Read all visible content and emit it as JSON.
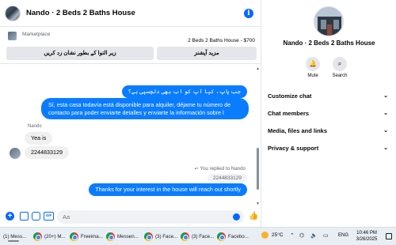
{
  "chat": {
    "title": "Nando · 2 Beds 2 Baths House",
    "marketplace_label": "Marketplace",
    "listing": "2 Beds 2 Baths House - $700",
    "btn_mark": "زیر التوا کے بطور نشان زد کریں",
    "btn_options": "مزید آپشنز",
    "messages": {
      "m1": "جب پاپ، کیا آپ کو اب بھی دلچسپی ہے؟",
      "m2": "Sí, esta casa todavía está disponible para alquiler, déjame tu número de contacto para poder enviarte detalles y enviarte la información sobre l",
      "sender": "Nando",
      "m3": "Yea is",
      "m4": "2244833129",
      "replied": "You replied to Nando",
      "quoted": "2244833129",
      "m5": "Thanks for your interest in the house will reach out shortly"
    },
    "composer_placeholder": "Aa"
  },
  "info": {
    "name": "Nando · 2 Beds 2 Baths House",
    "mute_label": "Mute",
    "search_label": "Search",
    "menu": [
      "Customize chat",
      "Chat members",
      "Media, files and links",
      "Privacy & support"
    ]
  },
  "taskbar": {
    "items": [
      "(1) Mess...",
      "(20+) M...",
      "Freeima...",
      "Messen...",
      "(3) Face...",
      "(3) Face...",
      "Facebo..."
    ],
    "temperature": "25°C",
    "language": "ENG",
    "time": "10:46 PM",
    "date": "3/26/2025"
  },
  "colors": {
    "accent": "#0866ff",
    "outgoing_bubble": "#0a7cff",
    "incoming_bubble": "#f0f0f0"
  },
  "icons": [
    "info-icon",
    "plus-icon",
    "image-icon",
    "sticker-icon",
    "gif-icon",
    "emoji-icon",
    "like-icon",
    "bell-icon",
    "search-icon",
    "chevron-down-icon",
    "chrome-icon",
    "sun-icon"
  ]
}
